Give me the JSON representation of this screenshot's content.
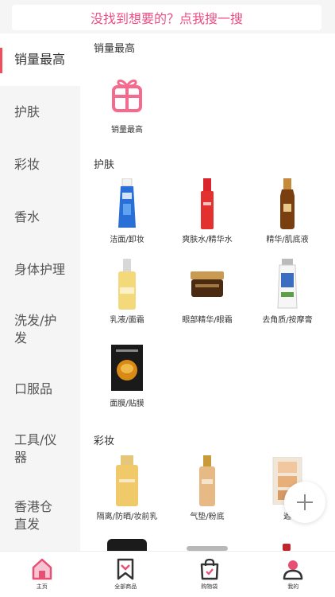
{
  "search": {
    "placeholder": "没找到想要的？点我搜一搜"
  },
  "sidebar": {
    "items": [
      {
        "label": "销量最高",
        "active": true
      },
      {
        "label": "护肤"
      },
      {
        "label": "彩妆"
      },
      {
        "label": "香水"
      },
      {
        "label": "身体护理"
      },
      {
        "label": "洗发/护发"
      },
      {
        "label": "口服品"
      },
      {
        "label": "工具/仪器"
      },
      {
        "label": "香港仓直发"
      }
    ]
  },
  "content": {
    "sections": [
      {
        "title": "销量最高",
        "items": [
          {
            "label": "销量最高",
            "icon": "gift-icon"
          }
        ]
      },
      {
        "title": "护肤",
        "items": [
          {
            "label": "洁面/卸妆",
            "icon": "cleanser-tube"
          },
          {
            "label": "爽肤水/精华水",
            "icon": "toner-bottle"
          },
          {
            "label": "精华/肌底液",
            "icon": "serum-bottle"
          },
          {
            "label": "乳液/面霜",
            "icon": "lotion-bottle"
          },
          {
            "label": "眼部精华/眼霜",
            "icon": "eye-cream-jar"
          },
          {
            "label": "去角质/按摩膏",
            "icon": "scrub-tube"
          },
          {
            "label": "面膜/贴膜",
            "icon": "face-mask-pack"
          }
        ]
      },
      {
        "title": "彩妆",
        "items": [
          {
            "label": "隔离/防晒/妆前乳",
            "icon": "sunscreen-bottle"
          },
          {
            "label": "气垫/粉底",
            "icon": "foundation-bottle"
          },
          {
            "label": "遮",
            "icon": "concealer-palette"
          }
        ]
      }
    ]
  },
  "tabbar": {
    "items": [
      {
        "label": "主页",
        "icon": "home-icon"
      },
      {
        "label": "全部商品",
        "icon": "bookmark-icon"
      },
      {
        "label": "购物袋",
        "icon": "shopping-bag-icon"
      },
      {
        "label": "我的",
        "icon": "user-icon"
      }
    ]
  },
  "colors": {
    "accent": "#ee4f83",
    "active_bar": "#ee4f5a",
    "sidebar_bg": "#f5f5f5"
  }
}
